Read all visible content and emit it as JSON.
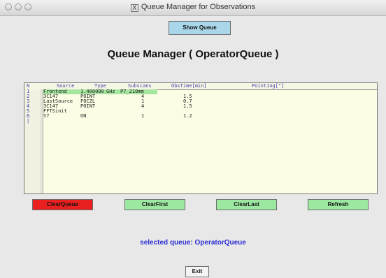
{
  "window": {
    "title": "Queue Manager for Observations",
    "icon": "x11-icon",
    "icon_glyph": "X"
  },
  "toolbar": {
    "show_queue_label": "Show Queue"
  },
  "heading": "Queue Manager ( OperatorQueue )",
  "table": {
    "columns": [
      "N",
      "Source",
      "Type",
      "Subscans",
      "ObsTime[min]",
      "Pointing[\"]"
    ],
    "line_numbers": [
      "1",
      "2",
      "3",
      "4",
      "5",
      "6",
      "|"
    ],
    "highlight_color": "#a6e7a0",
    "rows": [
      {
        "source": "Frontend",
        "type": "1.400000",
        "unit": "GHz",
        "subscans": "P7_210mm",
        "obstime": "",
        "pointing": "",
        "highlighted": true
      },
      {
        "source": "3C147",
        "type": "POINT",
        "unit": "",
        "subscans": "4",
        "obstime": "1.5",
        "pointing": "",
        "highlighted": false
      },
      {
        "source": "LastSource",
        "type": "FOCZL",
        "unit": "",
        "subscans": "1",
        "obstime": "0.7",
        "pointing": "",
        "highlighted": false
      },
      {
        "source": "3C147",
        "type": "POINT",
        "unit": "",
        "subscans": "4",
        "obstime": "1.5",
        "pointing": "",
        "highlighted": false
      },
      {
        "source": "FFTSinit",
        "type": "",
        "unit": "",
        "subscans": "",
        "obstime": "",
        "pointing": "",
        "highlighted": false
      },
      {
        "source": "S7",
        "type": "ON",
        "unit": "",
        "subscans": "1",
        "obstime": "1.2",
        "pointing": "",
        "highlighted": false
      }
    ]
  },
  "actions": {
    "clear_queue": "ClearQueue",
    "clear_first": "ClearFirst",
    "clear_last": "ClearLast",
    "refresh": "Refresh"
  },
  "status": "selected queue: OperatorQueue",
  "exit_label": "Exit",
  "colors": {
    "clear_queue_bg": "#ea1f1f",
    "action_bg": "#9de8a0",
    "show_queue_bg": "#a9d7e9",
    "status_text": "#2d2dd6",
    "table_bg": "#fdfde6"
  }
}
